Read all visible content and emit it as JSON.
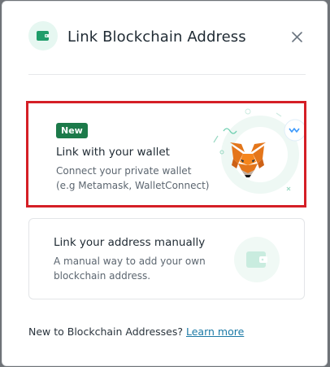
{
  "modal": {
    "title": "Link Blockchain Address",
    "icons": {
      "header": "wallet-icon",
      "close": "close-icon"
    }
  },
  "options": [
    {
      "badge": "New",
      "title": "Link with your wallet",
      "description": "Connect your private wallet (e.g Metamask, WalletConnect)",
      "icon": "metamask-fox-icon",
      "highlight_color": "#d51f26"
    },
    {
      "title": "Link your address manually",
      "description": "A manual way to add your own blockchain address.",
      "icon": "wallet-icon"
    }
  ],
  "footer": {
    "text": "New to Blockchain Addresses?",
    "link": "Learn more"
  },
  "colors": {
    "accent_green": "#1c7a4a",
    "mint": "#e6f7f1",
    "link": "#1c7aa6"
  }
}
